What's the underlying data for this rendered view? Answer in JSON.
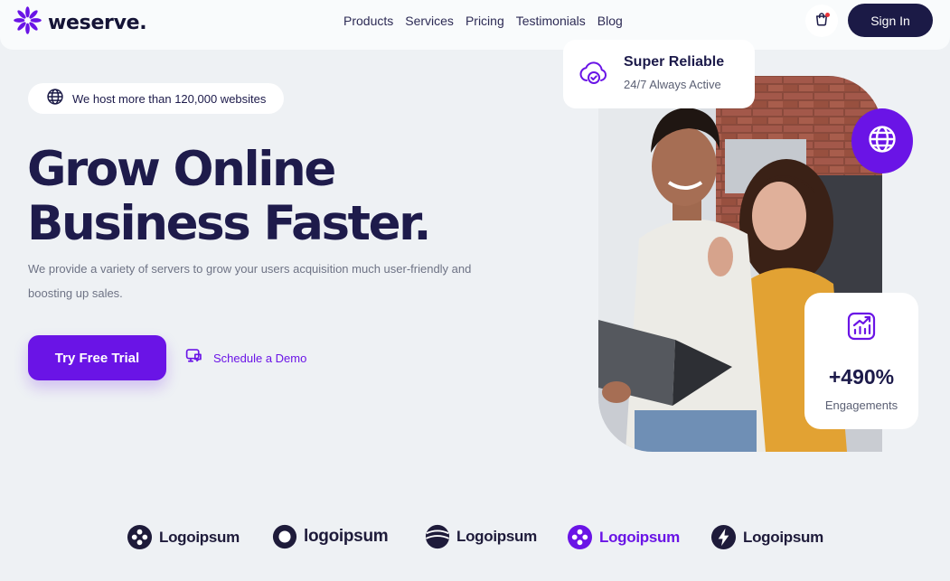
{
  "brand": {
    "name": "weserve.",
    "accent": "#6a14e6",
    "dark": "#1b1a46"
  },
  "nav": [
    {
      "label": "Products"
    },
    {
      "label": "Services"
    },
    {
      "label": "Pricing"
    },
    {
      "label": "Testimonials"
    },
    {
      "label": "Blog"
    }
  ],
  "header": {
    "cart_icon": "cart-icon",
    "signin_label": "Sign In"
  },
  "hero": {
    "badge": "We host more than 120,000 websites",
    "headline_line1": "Grow Online",
    "headline_line2": "Business Faster.",
    "description": "We provide a variety of servers to grow your users acquisition much user-friendly and boosting up sales.",
    "cta_primary": "Try Free Trial",
    "cta_secondary": "Schedule a Demo"
  },
  "cards": {
    "reliable": {
      "title": "Super Reliable",
      "subtitle": "24/7 Always Active"
    },
    "engagement": {
      "value": "+490%",
      "label": "Engagements"
    }
  },
  "partners": [
    {
      "name": "Logoipsum",
      "color": "#1e1b3a"
    },
    {
      "name": "logoipsum",
      "color": "#1e1b3a"
    },
    {
      "name": "Logoipsum",
      "color": "#1e1b3a"
    },
    {
      "name": "Logoipsum",
      "color": "#6a14e6"
    },
    {
      "name": "Logoipsum",
      "color": "#1e1b3a"
    }
  ]
}
